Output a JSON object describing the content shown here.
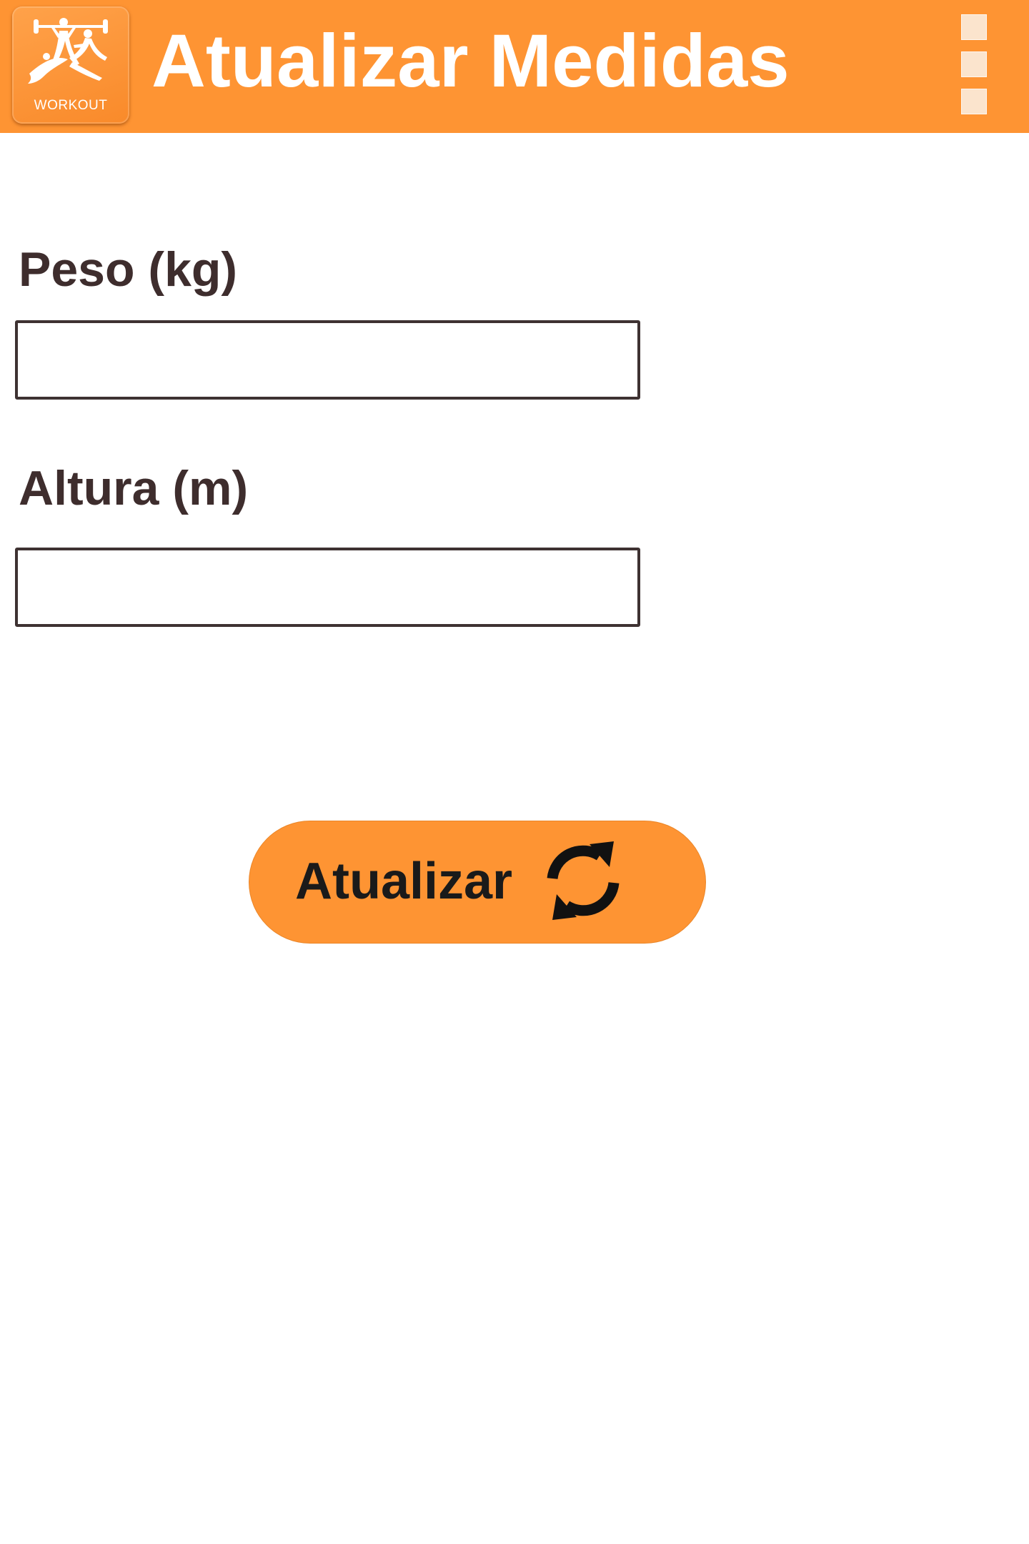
{
  "app_bar": {
    "logo_caption": "WORKOUT",
    "title": "Atualizar Medidas",
    "menu_icon": "overflow-menu-icon",
    "logo_icon": "workout-logo-icon",
    "color": "#fe9433"
  },
  "form": {
    "weight_label": "Peso (kg)",
    "weight_value": "",
    "height_label": "Altura (m)",
    "height_value": ""
  },
  "update_button": {
    "label": "Atualizar",
    "icon": "refresh-icon",
    "color": "#fe9433"
  }
}
